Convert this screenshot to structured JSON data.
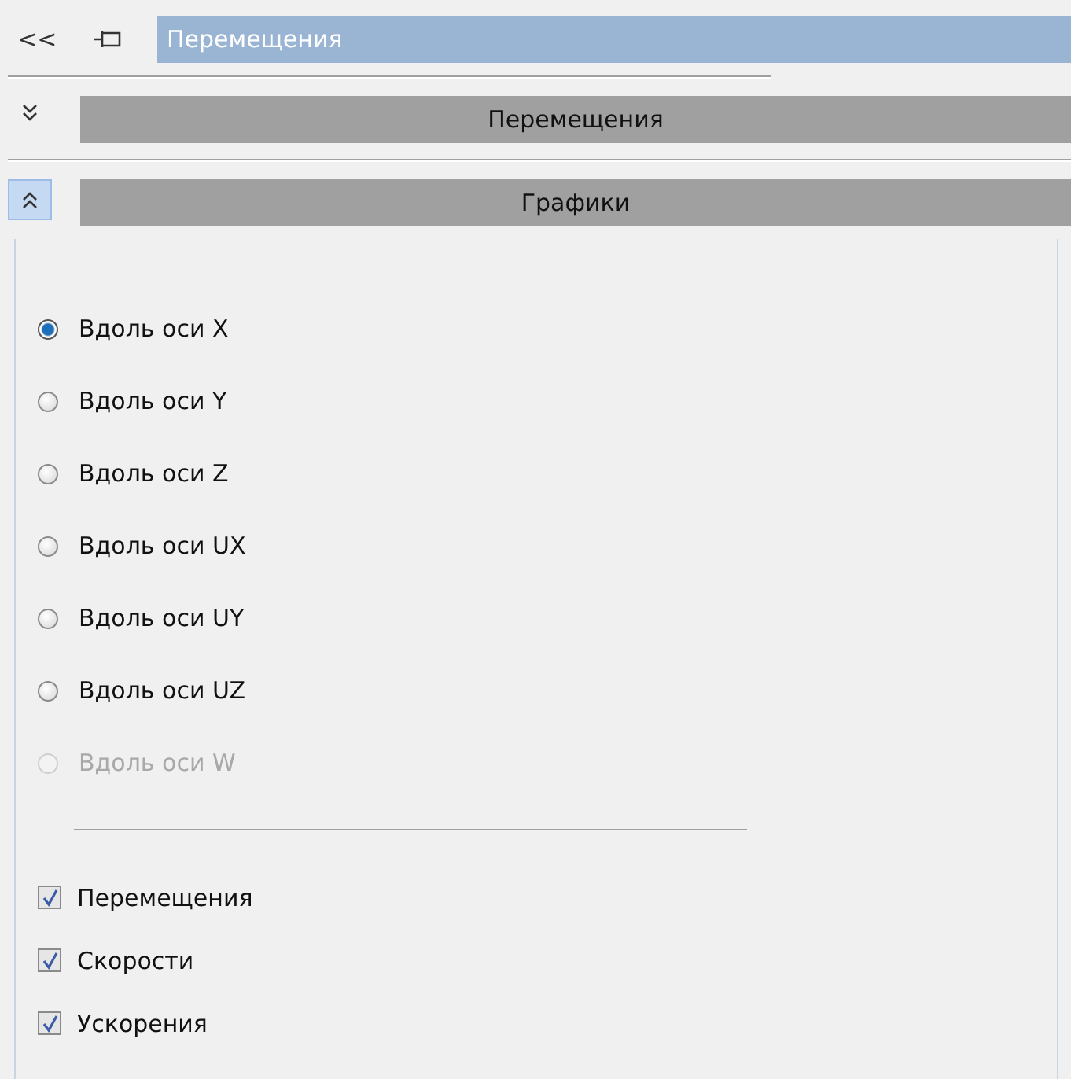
{
  "header": {
    "collapse_label": "<<",
    "title": "Перемещения"
  },
  "sections": [
    {
      "title": "Перемещения",
      "expanded": false
    },
    {
      "title": "Графики",
      "expanded": true
    }
  ],
  "axes": [
    {
      "label": "Вдоль оси X",
      "selected": true,
      "disabled": false
    },
    {
      "label": "Вдоль оси Y",
      "selected": false,
      "disabled": false
    },
    {
      "label": "Вдоль оси Z",
      "selected": false,
      "disabled": false
    },
    {
      "label": "Вдоль оси UX",
      "selected": false,
      "disabled": false
    },
    {
      "label": "Вдоль оси UY",
      "selected": false,
      "disabled": false
    },
    {
      "label": "Вдоль оси UZ",
      "selected": false,
      "disabled": false
    },
    {
      "label": "Вдоль оси W",
      "selected": false,
      "disabled": true
    }
  ],
  "plots": [
    {
      "label": "Перемещения",
      "checked": true
    },
    {
      "label": "Скорости",
      "checked": true
    },
    {
      "label": "Ускорения",
      "checked": true
    }
  ]
}
